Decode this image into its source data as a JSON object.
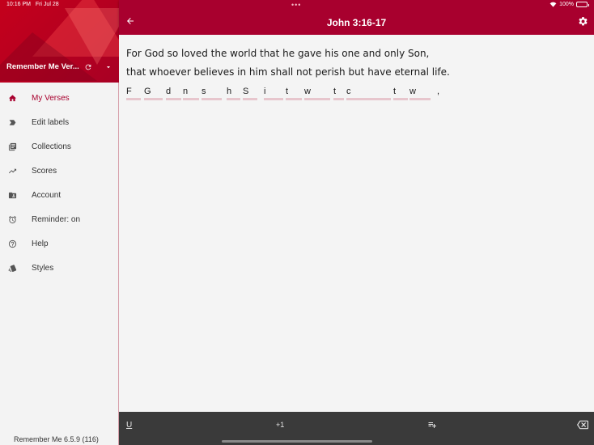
{
  "status": {
    "time": "10:16 PM",
    "date": "Fri Jul 28",
    "battery": "100%",
    "battery_level": 1.0
  },
  "sidebar": {
    "account_name": "Remember Me Ver...",
    "items": [
      {
        "label": "My Verses",
        "icon": "home-icon",
        "active": true
      },
      {
        "label": "Edit labels",
        "icon": "label-icon",
        "active": false
      },
      {
        "label": "Collections",
        "icon": "collections-icon",
        "active": false
      },
      {
        "label": "Scores",
        "icon": "trending-up-icon",
        "active": false
      },
      {
        "label": "Account",
        "icon": "account-folder-icon",
        "active": false
      },
      {
        "label": "Reminder: on",
        "icon": "alarm-icon",
        "active": false
      },
      {
        "label": "Help",
        "icon": "help-icon",
        "active": false
      },
      {
        "label": "Styles",
        "icon": "styles-icon",
        "active": false
      }
    ],
    "version": "Remember Me 6.5.9 (116)"
  },
  "header": {
    "title": "John 3:16-17"
  },
  "verse": {
    "line1": "For God so loved the world that he gave his one and only Son,",
    "line2": "that whoever believes in him shall not perish but have eternal life.",
    "hints": [
      "F",
      "G",
      "d",
      "n",
      "s",
      "h",
      "S",
      "i",
      "t",
      "w",
      "t",
      "c",
      "t",
      "w",
      ","
    ]
  },
  "toolbar": {
    "underline": "U",
    "plus_one": "+1"
  },
  "colors": {
    "primary": "#a8002e",
    "toolbar": "#3a3a3a",
    "hint_line": "#e7c6cd"
  }
}
